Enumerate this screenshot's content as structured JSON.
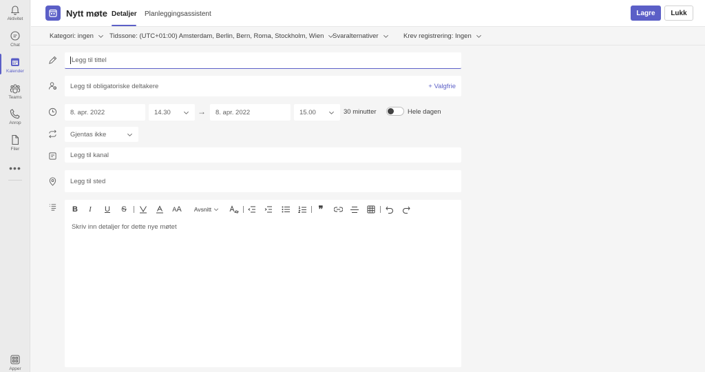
{
  "appbar": {
    "items": [
      {
        "label": "Aktivitet",
        "icon": "bell-icon"
      },
      {
        "label": "Chat",
        "icon": "chat-icon"
      },
      {
        "label": "Kalender",
        "icon": "calendar-icon",
        "active": true
      },
      {
        "label": "Teams",
        "icon": "teams-icon"
      },
      {
        "label": "Anrop",
        "icon": "phone-icon"
      },
      {
        "label": "Filer",
        "icon": "file-icon"
      }
    ],
    "more": "•••",
    "apps_label": "Apper"
  },
  "header": {
    "title": "Nytt møte",
    "tabs": [
      {
        "label": "Detaljer",
        "active": true
      },
      {
        "label": "Planleggingsassistent"
      }
    ],
    "save_label": "Lagre",
    "close_label": "Lukk"
  },
  "options": {
    "category": "Kategori: ingen",
    "timezone": "Tidssone: (UTC+01:00) Amsterdam, Berlin, Bern, Roma, Stockholm, Wien",
    "response": "Svaralternativer",
    "registration": "Krev registrering: Ingen"
  },
  "form": {
    "title_placeholder": "Legg til tittel",
    "attendees_placeholder": "Legg til obligatoriske deltakere",
    "optional_label": "+ Valgfrie",
    "start_date": "8. apr. 2022",
    "start_time": "14.30",
    "end_date": "8. apr. 2022",
    "end_time": "15.00",
    "duration": "30 minutter",
    "all_day_label": "Hele dagen",
    "all_day_on": false,
    "recurrence": "Gjentas ikke",
    "channel_placeholder": "Legg til kanal",
    "location_placeholder": "Legg til sted"
  },
  "editor": {
    "paragraph_label": "Avsnitt",
    "placeholder": "Skriv inn detaljer for dette nye møtet"
  },
  "colors": {
    "accent": "#5b5fc7"
  }
}
